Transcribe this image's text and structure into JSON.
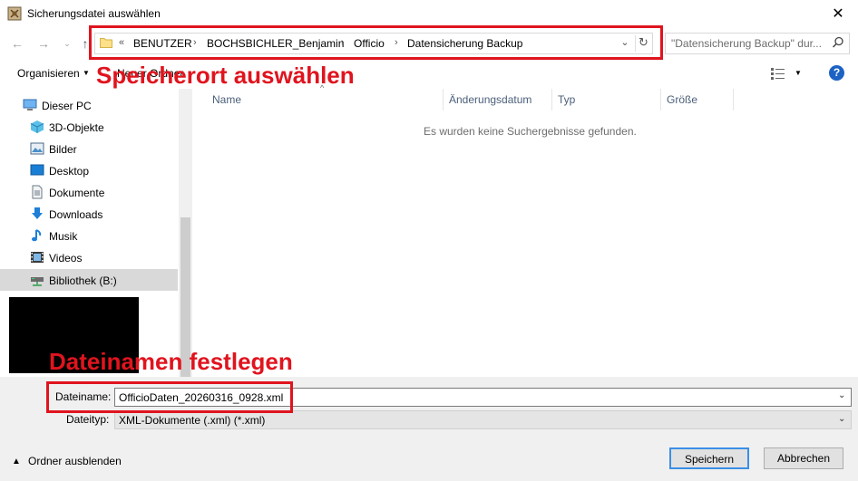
{
  "window": {
    "title": "Sicherungsdatei auswählen",
    "close_glyph": "✕"
  },
  "nav": {
    "back_glyph": "←",
    "forward_glyph": "→",
    "recent_glyph": "⌄",
    "up_glyph": "↑",
    "breadcrumb_prefix": "«",
    "breadcrumbs": [
      "BENUTZER",
      "BOCHSBICHLER_Benjamin",
      "Officio",
      "Datensicherung Backup"
    ],
    "separator": "›",
    "dropdown_glyph": "⌄",
    "refresh_glyph": "↻",
    "search_placeholder": "\"Datensicherung Backup\" dur..."
  },
  "annotations": {
    "location": "Speicherort auswählen",
    "filename": "Dateinamen festlegen"
  },
  "toolbar": {
    "organize_label": "Organisieren",
    "organize_arrow": "▼",
    "new_folder_label": "Neuer Ordner",
    "view_arrow": "▼",
    "help_label": "?"
  },
  "sidebar": {
    "items": [
      {
        "label": "Dieser PC",
        "icon": "pc-icon"
      },
      {
        "label": "3D-Objekte",
        "icon": "cube-icon"
      },
      {
        "label": "Bilder",
        "icon": "pictures-icon"
      },
      {
        "label": "Desktop",
        "icon": "desktop-icon"
      },
      {
        "label": "Dokumente",
        "icon": "documents-icon"
      },
      {
        "label": "Downloads",
        "icon": "download-icon"
      },
      {
        "label": "Musik",
        "icon": "music-icon"
      },
      {
        "label": "Videos",
        "icon": "video-icon"
      },
      {
        "label": "Bibliothek (B:)",
        "icon": "network-drive-icon"
      }
    ],
    "selected_index": 8
  },
  "file_list": {
    "columns": [
      "Name",
      "Änderungsdatum",
      "Typ",
      "Größe"
    ],
    "sort_caret": "^",
    "empty_message": "Es wurden keine Suchergebnisse gefunden."
  },
  "form": {
    "filename_label": "Dateiname:",
    "filename_value": "OfficioDaten_20260316_0928.xml",
    "filetype_label": "Dateityp:",
    "filetype_value": "XML-Dokumente (.xml) (*.xml)",
    "dropdown_glyph": "⌄"
  },
  "footer": {
    "hide_folders_arrow": "▲",
    "hide_folders_label": "Ordner ausblenden",
    "save_label": "Speichern",
    "cancel_label": "Abbrechen"
  },
  "colors": {
    "annotation_red": "#e0141e",
    "help_blue": "#1c62c4",
    "primary_button_border": "#3a8ee6"
  }
}
